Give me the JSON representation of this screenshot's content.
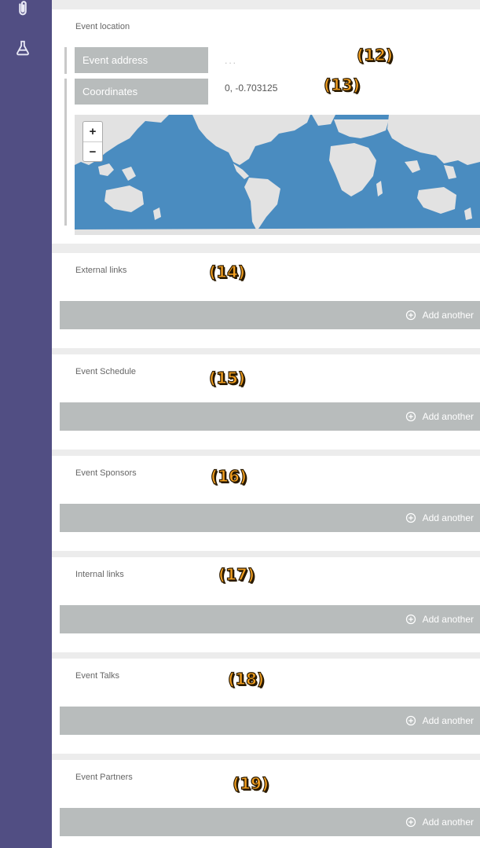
{
  "sidebar": {
    "icons": [
      {
        "name": "paperclip-icon"
      },
      {
        "name": "flask-icon"
      }
    ]
  },
  "location": {
    "title": "Event location",
    "address_label": "Event address",
    "address_value": "...",
    "coordinates_label": "Coordinates",
    "coordinates_value": "0, -0.703125",
    "zoom_in": "+",
    "zoom_out": "−"
  },
  "sections": [
    {
      "title": "External links",
      "add_label": "Add another",
      "badge": "(14)"
    },
    {
      "title": "Event Schedule",
      "add_label": "Add another",
      "badge": "(15)"
    },
    {
      "title": "Event Sponsors",
      "add_label": "Add another",
      "badge": "(16)"
    },
    {
      "title": "Internal links",
      "add_label": "Add another",
      "badge": "(17)"
    },
    {
      "title": "Event Talks",
      "add_label": "Add another",
      "badge": "(18)"
    },
    {
      "title": "Event Partners",
      "add_label": "Add another",
      "badge": "(19)"
    }
  ],
  "badges": {
    "address": "(12)",
    "coordinates": "(13)"
  },
  "colors": {
    "sidebar": "#514e83",
    "label_bg": "#b8bcbc",
    "map_water": "#4a8cc0",
    "badge": "#f4a020"
  }
}
